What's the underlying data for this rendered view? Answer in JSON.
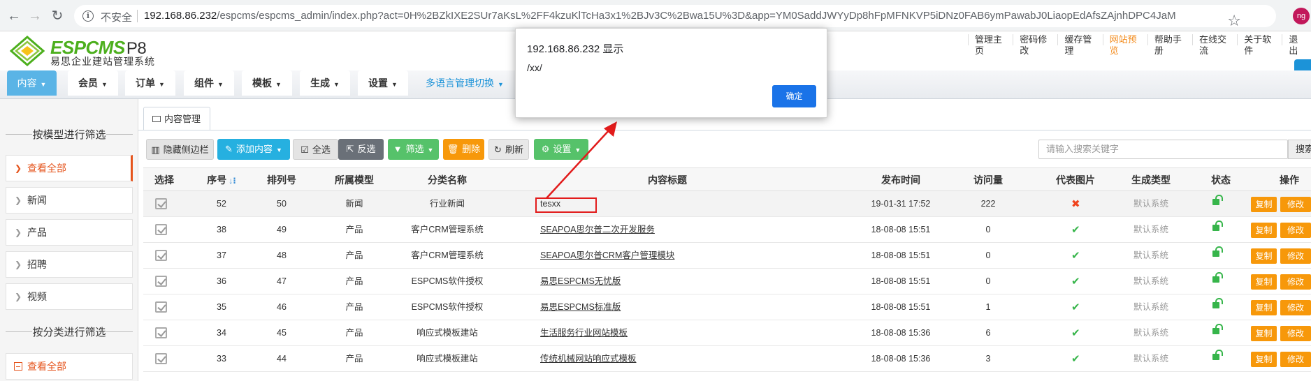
{
  "browser": {
    "security_label": "不安全",
    "url_host": "192.168.86.232",
    "url_path": "/espcms/espcms_admin/index.php?act=0H%2BZkIXE2SUr7aKsL%2FF4kzuKlTcHa3x1%2BJv3C%2Bwa15U%3D&app=YM0SaddJWYyDp8hFpMFNKVP5iDNz0FAB6ymPawabJ0LiaopEdAfsZAjnhDPC4JaM",
    "profile_initials": "ng"
  },
  "header": {
    "logo_brand": "ESPCMS",
    "logo_version": "P8",
    "logo_subtitle": "易思企业建站管理系统",
    "top_links": [
      {
        "label": "管理主页",
        "active": false
      },
      {
        "label": "密码修改",
        "active": false
      },
      {
        "label": "缓存管理",
        "active": false
      },
      {
        "label": "网站预览",
        "active": true
      },
      {
        "label": "帮助手册",
        "active": false
      },
      {
        "label": "在线交流",
        "active": false
      },
      {
        "label": "关于软件",
        "active": false
      },
      {
        "label": "退出",
        "active": false
      }
    ]
  },
  "main_nav": {
    "tabs": [
      "内容",
      "会员",
      "订单",
      "组件",
      "模板",
      "生成",
      "设置"
    ],
    "language_switch": "多语言管理切换"
  },
  "sidebar": {
    "model_filter_title": "按模型进行筛选",
    "model_items": [
      "查看全部",
      "新闻",
      "产品",
      "招聘",
      "视频"
    ],
    "category_filter_title": "按分类进行筛选",
    "category_all": "查看全部"
  },
  "content": {
    "tab_label": "内容管理",
    "toolbar": {
      "hide_sidebar": "隐藏侧边栏",
      "add_content": "添加内容",
      "select_all": "全选",
      "invert_select": "反选",
      "filter": "筛选",
      "delete": "删除",
      "refresh": "刷新",
      "settings": "设置"
    },
    "search_placeholder": "请输入搜索关键字",
    "search_button": "搜索"
  },
  "table": {
    "columns": [
      "选择",
      "序号",
      "排列号",
      "所属模型",
      "分类名称",
      "内容标题",
      "发布时间",
      "访问量",
      "代表图片",
      "生成类型",
      "状态",
      "操作"
    ],
    "op_copy": "复制",
    "op_edit": "修改",
    "rows": [
      {
        "id": "52",
        "order": "50",
        "model": "新闻",
        "category": "行业新闻",
        "title": "tesxx",
        "time": "19-01-31 17:52",
        "views": "222",
        "image": false,
        "gen": "默认系统"
      },
      {
        "id": "38",
        "order": "49",
        "model": "产品",
        "category": "客户CRM管理系统",
        "title": "SEAPOA思尔普二次开发服务",
        "time": "18-08-08 15:51",
        "views": "0",
        "image": true,
        "gen": "默认系统"
      },
      {
        "id": "37",
        "order": "48",
        "model": "产品",
        "category": "客户CRM管理系统",
        "title": "SEAPOA思尔普CRM客户管理模块",
        "time": "18-08-08 15:51",
        "views": "0",
        "image": true,
        "gen": "默认系统"
      },
      {
        "id": "36",
        "order": "47",
        "model": "产品",
        "category": "ESPCMS软件授权",
        "title": "易思ESPCMS无忧版",
        "time": "18-08-08 15:51",
        "views": "0",
        "image": true,
        "gen": "默认系统"
      },
      {
        "id": "35",
        "order": "46",
        "model": "产品",
        "category": "ESPCMS软件授权",
        "title": "易思ESPCMS标准版",
        "time": "18-08-08 15:51",
        "views": "1",
        "image": true,
        "gen": "默认系统"
      },
      {
        "id": "34",
        "order": "45",
        "model": "产品",
        "category": "响应式模板建站",
        "title": "生活服务行业网站模板",
        "time": "18-08-08 15:36",
        "views": "6",
        "image": true,
        "gen": "默认系统"
      },
      {
        "id": "33",
        "order": "44",
        "model": "产品",
        "category": "响应式模板建站",
        "title": "传统机械网站响应式模板",
        "time": "18-08-08 15:36",
        "views": "3",
        "image": true,
        "gen": "默认系统"
      }
    ]
  },
  "dialog": {
    "title": "192.168.86.232 显示",
    "message": "/xx/",
    "ok_label": "确定"
  },
  "colors": {
    "accent_blue": "#1c93d8",
    "brand_green": "#4caf1d",
    "orange": "#f7980a",
    "annotation_red": "#e21b1b"
  }
}
